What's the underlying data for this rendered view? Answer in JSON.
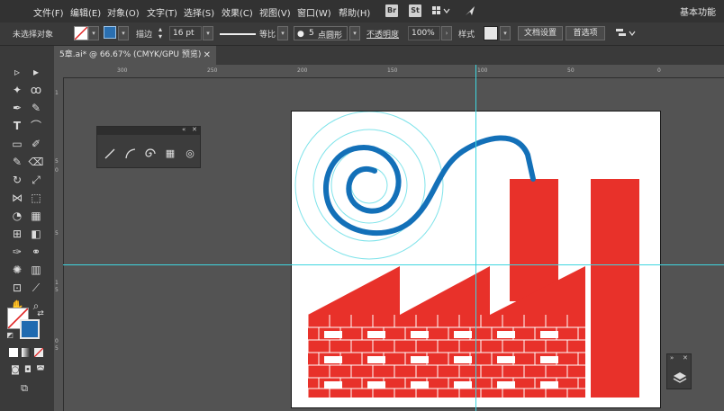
{
  "menubar": {
    "items": [
      "文件(F)",
      "编辑(E)",
      "对象(O)",
      "文字(T)",
      "选择(S)",
      "效果(C)",
      "视图(V)",
      "窗口(W)",
      "帮助(H)"
    ],
    "bridge_icon": "Br",
    "stock_icon": "St",
    "workspace": "基本功能"
  },
  "controlbar": {
    "selection_state": "未选择对象",
    "stroke_label": "描边",
    "stroke_weight": "16 pt",
    "profile": "等比",
    "brush_value": "5",
    "brush_label": "点圆形",
    "opacity_label": "不透明度",
    "opacity_value": "100%",
    "style_label": "样式",
    "doc_setup_button": "文档设置",
    "preferences_button": "首选项"
  },
  "document": {
    "tab_title": "5章.ai* @ 66.67% (CMYK/GPU 预览)",
    "close_glyph": "✕"
  },
  "rulers": {
    "h_ticks": [
      "300",
      "250",
      "200",
      "150",
      "100",
      "50",
      "0"
    ],
    "v_ticks": [
      "1",
      "5",
      "0",
      "5",
      "1",
      "5",
      "0",
      "5"
    ]
  },
  "colors": {
    "guide": "#3fd6e0",
    "factory_red": "#e8312a",
    "spiral_blue": "#1370b8"
  },
  "icons": {
    "panel_tools": [
      "line-segment-icon",
      "arc-icon",
      "spiral-icon",
      "rectangular-grid-icon",
      "polar-grid-icon"
    ],
    "layers": "layers-icon"
  }
}
